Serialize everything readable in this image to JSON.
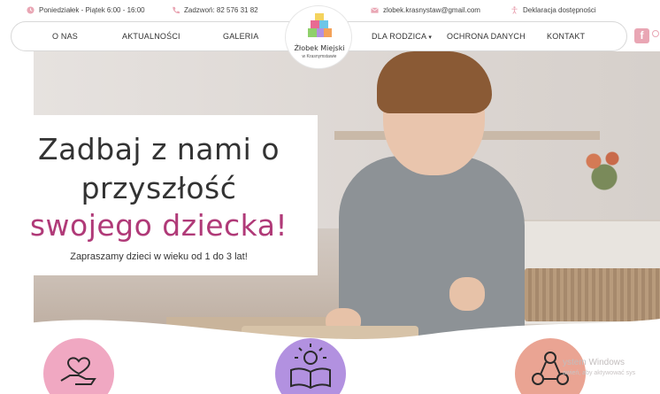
{
  "topbar": {
    "hours": "Poniedziałek - Piątek 6:00 - 16:00",
    "phone": "Zadzwoń: 82 576 31 82",
    "email": "zlobek.krasnystaw@gmail.com",
    "accessibility": "Deklaracja dostępności"
  },
  "nav": {
    "items": [
      "O NAS",
      "AKTUALNOŚCI",
      "GALERIA",
      "DLA RODZICA",
      "OCHRONA DANYCH",
      "KONTAKT"
    ],
    "logo_title": "Żłobek Miejski",
    "logo_sub": "w Krasnymstawie",
    "facebook": "f"
  },
  "hero": {
    "line1": "Zadbaj z nami o",
    "line2": "przyszłość",
    "line3": "swojego dziecka!",
    "subtitle": "Zapraszamy dzieci w wieku od 1 do 3 lat!"
  },
  "watermark": {
    "title": "ystem Windows",
    "text": "awień, aby aktywować sys"
  },
  "colors": {
    "accent": "#b03a78",
    "pink": "#f0a8c2",
    "purple": "#b291e0",
    "salmon": "#eaa493"
  },
  "icons": [
    "clock-icon",
    "phone-icon",
    "mail-icon",
    "accessibility-icon",
    "facebook-icon",
    "heart-hand-icon",
    "book-idea-icon",
    "people-network-icon"
  ]
}
